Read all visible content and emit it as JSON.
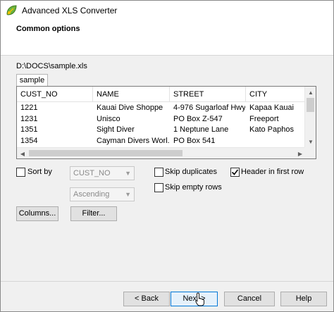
{
  "window": {
    "title": "Advanced XLS Converter",
    "icon": "xls-converter-leaf-icon"
  },
  "header": {
    "title": "Common options"
  },
  "file": {
    "path": "D:\\DOCS\\sample.xls"
  },
  "tabs": [
    {
      "label": "sample",
      "selected": true
    }
  ],
  "grid": {
    "columns": [
      "CUST_NO",
      "NAME",
      "STREET",
      "CITY"
    ],
    "rows": [
      [
        "1221",
        "Kauai Dive Shoppe",
        "4-976 Sugarloaf Hwy",
        "Kapaa Kauai"
      ],
      [
        "1231",
        "Unisco",
        "PO Box Z-547",
        "Freeport"
      ],
      [
        "1351",
        "Sight Diver",
        "1 Neptune Lane",
        "Kato Paphos"
      ],
      [
        "1354",
        "Cayman Divers Worl...",
        "PO Box 541",
        ""
      ]
    ]
  },
  "options": {
    "sort_by": {
      "label": "Sort by",
      "checked": false
    },
    "sort_field": {
      "value": "CUST_NO",
      "enabled": false
    },
    "sort_order": {
      "value": "Ascending",
      "enabled": false
    },
    "skip_duplicates": {
      "label": "Skip duplicates",
      "checked": false
    },
    "header_in_first_row": {
      "label": "Header in first row",
      "checked": true
    },
    "skip_empty_rows": {
      "label": "Skip empty rows",
      "checked": false
    }
  },
  "buttons": {
    "columns": "Columns...",
    "filter": "Filter...",
    "back": "< Back",
    "next": "Next >",
    "cancel": "Cancel",
    "help": "Help"
  },
  "colors": {
    "focus_border": "#0078d7",
    "button_face": "#e1e1e1"
  }
}
